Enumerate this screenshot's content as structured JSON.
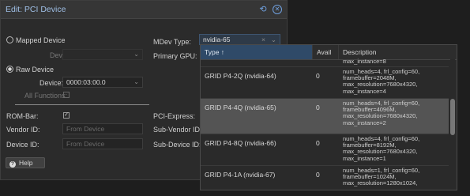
{
  "dialog": {
    "title": "Edit: PCI Device",
    "mapped_device_label": "Mapped Device",
    "device_label": "Device:",
    "raw_device_label": "Raw Device",
    "raw_device_field_label": "Device:",
    "raw_device_value": "0000:03:00.0",
    "all_functions_label": "All Functions:",
    "mdev_type_label": "MDev Type:",
    "mdev_type_value": "nvidia-65",
    "primary_gpu_label": "Primary GPU:",
    "rom_bar_label": "ROM-Bar:",
    "pci_express_label": "PCI-Express:",
    "vendor_id_label": "Vendor ID:",
    "vendor_id_placeholder": "From Device",
    "sub_vendor_id_label": "Sub-Vendor ID:",
    "device_id_label": "Device ID:",
    "device_id_placeholder": "From Device",
    "sub_device_id_label": "Sub-Device ID:",
    "help_label": "Help"
  },
  "popup": {
    "columns": [
      "Type ↑",
      "Avail",
      "Description"
    ],
    "partial_top": "max_instance=8",
    "rows": [
      {
        "type": "GRID P4-2Q (nvidia-64)",
        "avail": "0",
        "desc": [
          "num_heads=4, frl_config=60,",
          "framebuffer=2048M,",
          "max_resolution=7680x4320,",
          "max_instance=4"
        ],
        "selected": false
      },
      {
        "type": "GRID P4-4Q (nvidia-65)",
        "avail": "0",
        "desc": [
          "num_heads=4, frl_config=60,",
          "framebuffer=4096M,",
          "max_resolution=7680x4320,",
          "max_instance=2"
        ],
        "selected": true
      },
      {
        "type": "GRID P4-8Q (nvidia-66)",
        "avail": "0",
        "desc": [
          "num_heads=4, frl_config=60,",
          "framebuffer=8192M,",
          "max_resolution=7680x4320,",
          "max_instance=1"
        ],
        "selected": false
      },
      {
        "type": "GRID P4-1A (nvidia-67)",
        "avail": "0",
        "desc": [
          "num_heads=1, frl_config=60,",
          "framebuffer=1024M,",
          "max_resolution=1280x1024,"
        ],
        "selected": false
      }
    ]
  },
  "colors": {
    "accent": "#6fa0df",
    "header_selected": "#2f4a68",
    "row_selected": "#545454"
  }
}
